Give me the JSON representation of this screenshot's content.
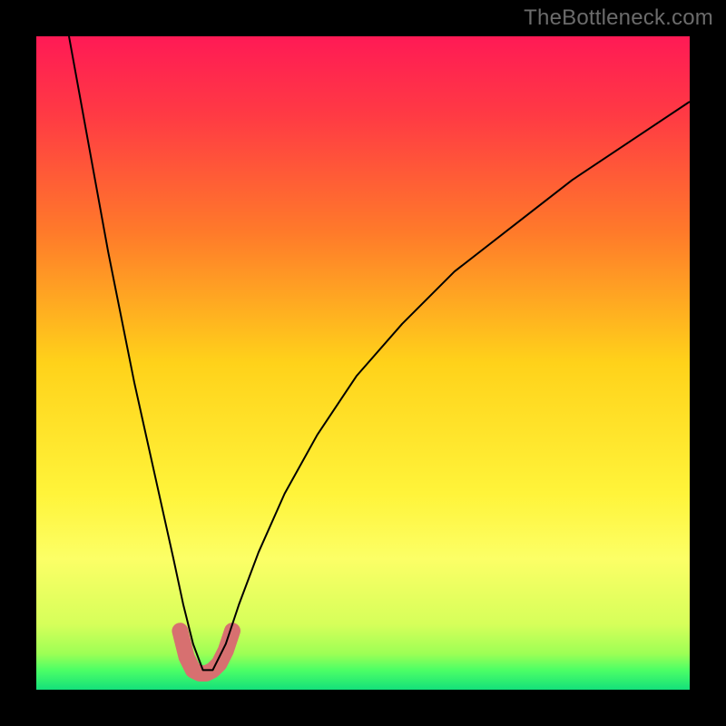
{
  "watermark": {
    "text": "TheBottleneck.com"
  },
  "chart_data": {
    "type": "line",
    "title": "",
    "xlabel": "",
    "ylabel": "",
    "xlim": [
      0,
      100
    ],
    "ylim": [
      0,
      100
    ],
    "grid": false,
    "background": {
      "type": "vertical-gradient",
      "stops": [
        {
          "offset": 0.0,
          "color": "#ff1a55"
        },
        {
          "offset": 0.12,
          "color": "#ff3a44"
        },
        {
          "offset": 0.3,
          "color": "#ff7a2a"
        },
        {
          "offset": 0.5,
          "color": "#ffd21a"
        },
        {
          "offset": 0.7,
          "color": "#fff43a"
        },
        {
          "offset": 0.8,
          "color": "#fcff66"
        },
        {
          "offset": 0.9,
          "color": "#d6ff5a"
        },
        {
          "offset": 0.945,
          "color": "#9dff55"
        },
        {
          "offset": 0.97,
          "color": "#4cff66"
        },
        {
          "offset": 1.0,
          "color": "#14e07a"
        }
      ]
    },
    "series": [
      {
        "name": "bottleneck-curve",
        "color": "#000000",
        "width": 2,
        "x": [
          5,
          7,
          9,
          11,
          13,
          15,
          17,
          19,
          21,
          22.5,
          24,
          25.5,
          27,
          29,
          31,
          34,
          38,
          43,
          49,
          56,
          64,
          73,
          82,
          91,
          100
        ],
        "y": [
          100,
          89,
          78,
          67,
          57,
          47,
          38,
          29,
          20,
          13,
          7,
          3,
          3,
          7,
          13,
          21,
          30,
          39,
          48,
          56,
          64,
          71,
          78,
          84,
          90
        ]
      }
    ],
    "highlight": {
      "name": "valley-marker",
      "color": "#d77070",
      "width": 18,
      "cap": "round",
      "x": [
        22,
        23,
        24,
        25,
        26,
        27,
        28,
        29,
        30
      ],
      "y": [
        9,
        5,
        3,
        2.5,
        2.5,
        3,
        4,
        6,
        9
      ]
    }
  }
}
